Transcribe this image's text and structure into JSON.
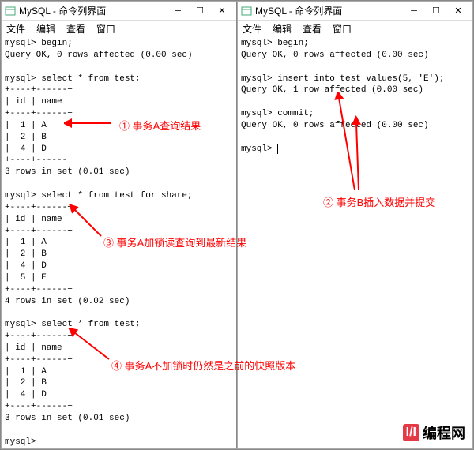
{
  "window_title": "MySQL - 命令列界面",
  "menu": {
    "file": "文件",
    "edit": "编辑",
    "view": "查看",
    "window": "窗口"
  },
  "left": {
    "lines": "mysql> begin;\nQuery OK, 0 rows affected (0.00 sec)\n\nmysql> select * from test;\n+----+------+\n| id | name |\n+----+------+\n|  1 | A    |\n|  2 | B    |\n|  4 | D    |\n+----+------+\n3 rows in set (0.01 sec)\n\nmysql> select * from test for share;\n+----+------+\n| id | name |\n+----+------+\n|  1 | A    |\n|  2 | B    |\n|  4 | D    |\n|  5 | E    |\n+----+------+\n4 rows in set (0.02 sec)\n\nmysql> select * from test;\n+----+------+\n| id | name |\n+----+------+\n|  1 | A    |\n|  2 | B    |\n|  4 | D    |\n+----+------+\n3 rows in set (0.01 sec)\n\nmysql>"
  },
  "right": {
    "lines": "mysql> begin;\nQuery OK, 0 rows affected (0.00 sec)\n\nmysql> insert into test values(5, 'E');\nQuery OK, 1 row affected (0.00 sec)\n\nmysql> commit;\nQuery OK, 0 rows affected (0.00 sec)\n\nmysql> "
  },
  "annotations": {
    "a1": "① 事务A查询结果",
    "a2": "② 事务B插入数据并提交",
    "a3": "③ 事务A加锁读查询到最新结果",
    "a4": "④ 事务A不加锁时仍然是之前的快照版本"
  },
  "logo": {
    "box": "I/I",
    "text": "编程网"
  },
  "controls": {
    "min": "─",
    "max": "☐",
    "close": "✕"
  }
}
